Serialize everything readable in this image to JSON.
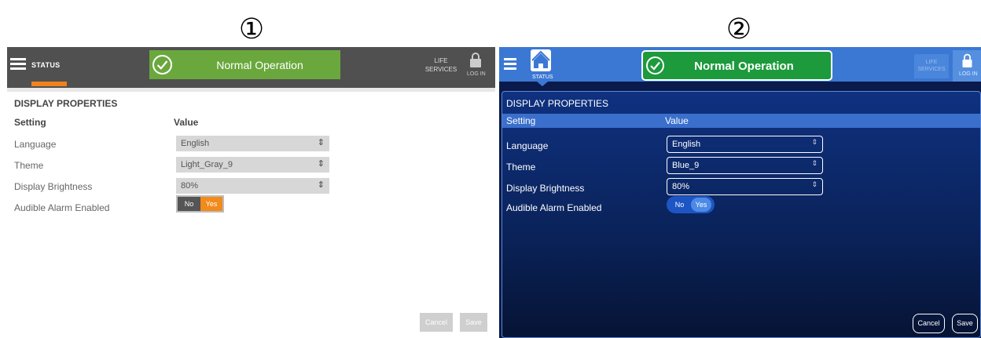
{
  "markers": [
    "①",
    "②"
  ],
  "panel1": {
    "menu_icon": "hamburger-icon",
    "status_label": "STATUS",
    "banner_text": "Normal Operation",
    "banner_icon": "check-circle-icon",
    "life_services": "LIFE SERVICES",
    "login_label": "LOG IN",
    "lock_icon": "lock-icon",
    "section_title": "DISPLAY PROPERTIES",
    "headers": {
      "setting": "Setting",
      "value": "Value"
    },
    "rows": [
      {
        "label": "Language",
        "value": "English"
      },
      {
        "label": "Theme",
        "value": "Light_Gray_9"
      },
      {
        "label": "Display Brightness",
        "value": "80%"
      },
      {
        "label": "Audible Alarm Enabled",
        "value": "Yes"
      }
    ],
    "toggle": {
      "no": "No",
      "yes": "Yes"
    },
    "cancel": "Cancel",
    "save": "Save",
    "colors": {
      "banner": "#6aa83d",
      "accent": "#f0821e",
      "bar": "#505050"
    }
  },
  "panel2": {
    "menu_icon": "hamburger-icon",
    "home_icon": "home-icon",
    "status_label": "STATUS",
    "banner_text": "Normal Operation",
    "banner_icon": "check-circle-icon",
    "life_services": "LIFE SERVICES",
    "login_label": "LOG IN",
    "lock_icon": "lock-icon",
    "section_title": "DISPLAY PROPERTIES",
    "headers": {
      "setting": "Setting",
      "value": "Value"
    },
    "rows": [
      {
        "label": "Language",
        "value": "English"
      },
      {
        "label": "Theme",
        "value": "Blue_9"
      },
      {
        "label": "Display Brightness",
        "value": "80%"
      },
      {
        "label": "Audible Alarm Enabled",
        "value": "Yes"
      }
    ],
    "toggle": {
      "no": "No",
      "yes": "Yes"
    },
    "cancel": "Cancel",
    "save": "Save",
    "colors": {
      "banner": "#1c9a3c",
      "bar": "#3b78d4",
      "background": "#0a2258"
    }
  }
}
